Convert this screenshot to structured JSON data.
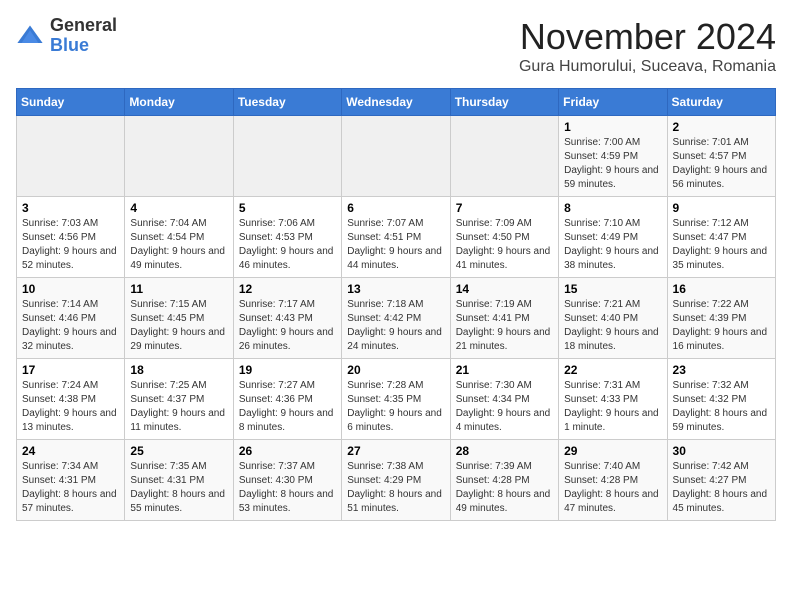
{
  "logo": {
    "general": "General",
    "blue": "Blue"
  },
  "title": {
    "month": "November 2024",
    "location": "Gura Humorului, Suceava, Romania"
  },
  "headers": [
    "Sunday",
    "Monday",
    "Tuesday",
    "Wednesday",
    "Thursday",
    "Friday",
    "Saturday"
  ],
  "weeks": [
    [
      {
        "day": "",
        "info": ""
      },
      {
        "day": "",
        "info": ""
      },
      {
        "day": "",
        "info": ""
      },
      {
        "day": "",
        "info": ""
      },
      {
        "day": "",
        "info": ""
      },
      {
        "day": "1",
        "info": "Sunrise: 7:00 AM\nSunset: 4:59 PM\nDaylight: 9 hours and 59 minutes."
      },
      {
        "day": "2",
        "info": "Sunrise: 7:01 AM\nSunset: 4:57 PM\nDaylight: 9 hours and 56 minutes."
      }
    ],
    [
      {
        "day": "3",
        "info": "Sunrise: 7:03 AM\nSunset: 4:56 PM\nDaylight: 9 hours and 52 minutes."
      },
      {
        "day": "4",
        "info": "Sunrise: 7:04 AM\nSunset: 4:54 PM\nDaylight: 9 hours and 49 minutes."
      },
      {
        "day": "5",
        "info": "Sunrise: 7:06 AM\nSunset: 4:53 PM\nDaylight: 9 hours and 46 minutes."
      },
      {
        "day": "6",
        "info": "Sunrise: 7:07 AM\nSunset: 4:51 PM\nDaylight: 9 hours and 44 minutes."
      },
      {
        "day": "7",
        "info": "Sunrise: 7:09 AM\nSunset: 4:50 PM\nDaylight: 9 hours and 41 minutes."
      },
      {
        "day": "8",
        "info": "Sunrise: 7:10 AM\nSunset: 4:49 PM\nDaylight: 9 hours and 38 minutes."
      },
      {
        "day": "9",
        "info": "Sunrise: 7:12 AM\nSunset: 4:47 PM\nDaylight: 9 hours and 35 minutes."
      }
    ],
    [
      {
        "day": "10",
        "info": "Sunrise: 7:14 AM\nSunset: 4:46 PM\nDaylight: 9 hours and 32 minutes."
      },
      {
        "day": "11",
        "info": "Sunrise: 7:15 AM\nSunset: 4:45 PM\nDaylight: 9 hours and 29 minutes."
      },
      {
        "day": "12",
        "info": "Sunrise: 7:17 AM\nSunset: 4:43 PM\nDaylight: 9 hours and 26 minutes."
      },
      {
        "day": "13",
        "info": "Sunrise: 7:18 AM\nSunset: 4:42 PM\nDaylight: 9 hours and 24 minutes."
      },
      {
        "day": "14",
        "info": "Sunrise: 7:19 AM\nSunset: 4:41 PM\nDaylight: 9 hours and 21 minutes."
      },
      {
        "day": "15",
        "info": "Sunrise: 7:21 AM\nSunset: 4:40 PM\nDaylight: 9 hours and 18 minutes."
      },
      {
        "day": "16",
        "info": "Sunrise: 7:22 AM\nSunset: 4:39 PM\nDaylight: 9 hours and 16 minutes."
      }
    ],
    [
      {
        "day": "17",
        "info": "Sunrise: 7:24 AM\nSunset: 4:38 PM\nDaylight: 9 hours and 13 minutes."
      },
      {
        "day": "18",
        "info": "Sunrise: 7:25 AM\nSunset: 4:37 PM\nDaylight: 9 hours and 11 minutes."
      },
      {
        "day": "19",
        "info": "Sunrise: 7:27 AM\nSunset: 4:36 PM\nDaylight: 9 hours and 8 minutes."
      },
      {
        "day": "20",
        "info": "Sunrise: 7:28 AM\nSunset: 4:35 PM\nDaylight: 9 hours and 6 minutes."
      },
      {
        "day": "21",
        "info": "Sunrise: 7:30 AM\nSunset: 4:34 PM\nDaylight: 9 hours and 4 minutes."
      },
      {
        "day": "22",
        "info": "Sunrise: 7:31 AM\nSunset: 4:33 PM\nDaylight: 9 hours and 1 minute."
      },
      {
        "day": "23",
        "info": "Sunrise: 7:32 AM\nSunset: 4:32 PM\nDaylight: 8 hours and 59 minutes."
      }
    ],
    [
      {
        "day": "24",
        "info": "Sunrise: 7:34 AM\nSunset: 4:31 PM\nDaylight: 8 hours and 57 minutes."
      },
      {
        "day": "25",
        "info": "Sunrise: 7:35 AM\nSunset: 4:31 PM\nDaylight: 8 hours and 55 minutes."
      },
      {
        "day": "26",
        "info": "Sunrise: 7:37 AM\nSunset: 4:30 PM\nDaylight: 8 hours and 53 minutes."
      },
      {
        "day": "27",
        "info": "Sunrise: 7:38 AM\nSunset: 4:29 PM\nDaylight: 8 hours and 51 minutes."
      },
      {
        "day": "28",
        "info": "Sunrise: 7:39 AM\nSunset: 4:28 PM\nDaylight: 8 hours and 49 minutes."
      },
      {
        "day": "29",
        "info": "Sunrise: 7:40 AM\nSunset: 4:28 PM\nDaylight: 8 hours and 47 minutes."
      },
      {
        "day": "30",
        "info": "Sunrise: 7:42 AM\nSunset: 4:27 PM\nDaylight: 8 hours and 45 minutes."
      }
    ]
  ]
}
